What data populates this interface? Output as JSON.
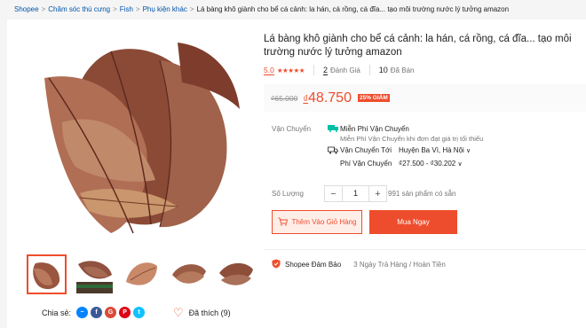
{
  "breadcrumb": {
    "items": [
      "Shopee",
      "Chăm sóc thú cưng",
      "Fish",
      "Phụ kiện khác"
    ],
    "separator": ">",
    "current": "Lá bàng khô giành cho bể cá cảnh: la hán, cá rồng, cá đĩa... tạo môi trường nước lý tưởng amazon"
  },
  "product": {
    "title": "Lá bàng khô giành cho bể cá cảnh: la hán, cá rồng, cá đĩa... tạo môi trường nước lý tưởng amazon",
    "rating": "5.0",
    "stars": "★★★★★",
    "rating_value": 5,
    "review_count": "2",
    "review_label": "Đánh Giá",
    "sold_count": "10",
    "sold_label": "Đã Bán",
    "old_price": "₫65.000",
    "currency": "₫",
    "new_price": "48.750",
    "discount_badge": "25% GIẢM"
  },
  "shipping": {
    "label": "Vận Chuyển",
    "free_title": "Miễn Phí Vận Chuyển",
    "free_sub": "Miễn Phí Vận Chuyển khi đơn đạt giá trị tối thiểu",
    "to_label": "Vận Chuyển Tới",
    "to_value": "Huyện Ba Vì, Hà Nội",
    "fee_label": "Phí Vận Chuyển",
    "fee_value": "₫27.500 - ₫30.202"
  },
  "quantity": {
    "label": "Số Lượng",
    "minus": "−",
    "plus": "+",
    "value": "1",
    "available": "991 sản phẩm có sẵn"
  },
  "actions": {
    "add_to_cart": "Thêm Vào Giỏ Hàng",
    "buy_now": "Mua Ngay"
  },
  "guarantee": {
    "title": "Shopee Đảm Bảo",
    "subtitle": "3 Ngày Trả Hàng / Hoàn Tiền"
  },
  "share": {
    "label": "Chia sẻ:",
    "icons": [
      "messenger-icon",
      "facebook-icon",
      "google-plus-icon",
      "pinterest-icon",
      "twitter-icon"
    ]
  },
  "like": {
    "label": "Đã thích (9)"
  },
  "colors": {
    "brand": "#ee4d2d",
    "link": "#0055aa",
    "free_ship": "#00bfa5"
  }
}
